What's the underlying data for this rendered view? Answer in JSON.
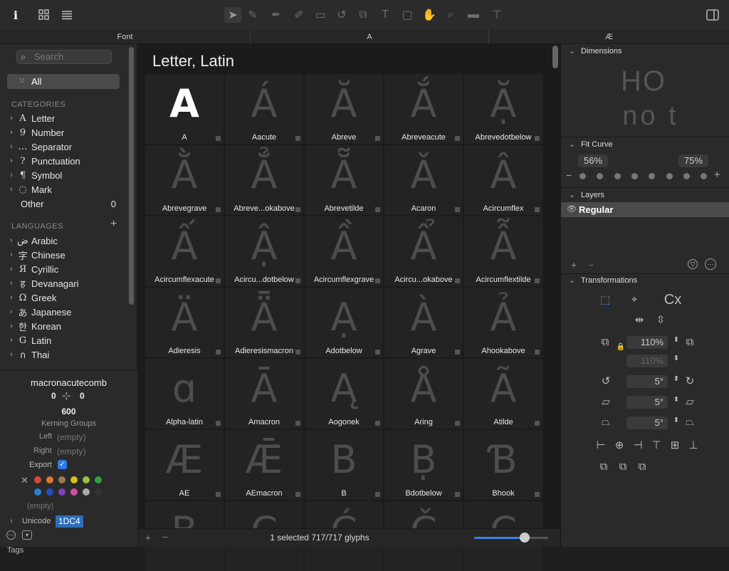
{
  "toolbar": {
    "left_icons": [
      "info-icon",
      "grid-view-icon",
      "list-view-icon"
    ],
    "tools": [
      "pointer-tool-icon",
      "edit-tool-icon",
      "pen-tool-icon",
      "brush-tool-icon",
      "rectangle-tool-icon",
      "rotate-tool-icon",
      "transform-tool-icon",
      "text-tool-icon",
      "annotation-tool-icon",
      "hand-tool-icon",
      "zoom-tool-icon",
      "measure-tool-icon",
      "trim-tool-icon"
    ],
    "right_icon": "sidebar-toggle-icon"
  },
  "tabs": [
    "Font",
    "A",
    "Æ"
  ],
  "sidebar": {
    "search_placeholder": "Search",
    "all_label": "All",
    "categories_header": "CATEGORIES",
    "categories": [
      {
        "icon": "A",
        "label": "Letter"
      },
      {
        "icon": "9",
        "label": "Number"
      },
      {
        "icon": "…",
        "label": "Separator"
      },
      {
        "icon": "?",
        "label": "Punctuation"
      },
      {
        "icon": "¶",
        "label": "Symbol"
      },
      {
        "icon": "◌",
        "label": "Mark"
      }
    ],
    "other_label": "Other",
    "other_count": "0",
    "languages_header": "LANGUAGES",
    "languages": [
      {
        "icon": "ض",
        "label": "Arabic"
      },
      {
        "icon": "字",
        "label": "Chinese"
      },
      {
        "icon": "Я",
        "label": "Cyrillic"
      },
      {
        "icon": "ह",
        "label": "Devanagari"
      },
      {
        "icon": "Ω",
        "label": "Greek"
      },
      {
        "icon": "あ",
        "label": "Japanese"
      },
      {
        "icon": "한",
        "label": "Korean"
      },
      {
        "icon": "G",
        "label": "Latin"
      },
      {
        "icon": "ก",
        "label": "Thai"
      }
    ],
    "glyph_info": {
      "name": "macronacutecomb",
      "lsb": "0",
      "rsb": "0",
      "width": "600",
      "kerning_groups": "Kerning Groups",
      "left_label": "Left",
      "left_value": "(empty)",
      "right_label": "Right",
      "right_value": "(empty)",
      "export_label": "Export",
      "tags_label": "Tags",
      "tags_value": "(empty)",
      "unicode_label": "Unicode",
      "unicode_value": "1DC4"
    },
    "colors": [
      "#d24a3a",
      "#e07a30",
      "#a07a50",
      "#d6c020",
      "#9ac040",
      "#30a040",
      "#2a80d0",
      "#2050c0",
      "#8040c0",
      "#d050a0",
      "#aaaaaa",
      "#333333"
    ]
  },
  "main": {
    "title": "Letter, Latin",
    "glyphs": [
      {
        "char": "A",
        "name": "A",
        "selected": true
      },
      {
        "char": "Á",
        "name": "Aacute"
      },
      {
        "char": "Ă",
        "name": "Abreve"
      },
      {
        "char": "Ắ",
        "name": "Abreveacute"
      },
      {
        "char": "Ặ",
        "name": "Abrevedotbelow"
      },
      {
        "char": "Ằ",
        "name": "Abrevegrave"
      },
      {
        "char": "Ẳ",
        "name": "Abreve...okabove"
      },
      {
        "char": "Ẵ",
        "name": "Abrevetilde"
      },
      {
        "char": "Ǎ",
        "name": "Acaron"
      },
      {
        "char": "Â",
        "name": "Acircumflex"
      },
      {
        "char": "Ấ",
        "name": "Acircumflexacute"
      },
      {
        "char": "Ậ",
        "name": "Acircu...dotbelow"
      },
      {
        "char": "Ầ",
        "name": "Acircumflexgrave"
      },
      {
        "char": "Ẩ",
        "name": "Acircu...okabove"
      },
      {
        "char": "Ẫ",
        "name": "Acircumflextilde"
      },
      {
        "char": "Ä",
        "name": "Adieresis"
      },
      {
        "char": "Ǟ",
        "name": "Adieresismacron"
      },
      {
        "char": "Ạ",
        "name": "Adotbelow"
      },
      {
        "char": "À",
        "name": "Agrave"
      },
      {
        "char": "Ả",
        "name": "Ahookabove"
      },
      {
        "char": "ɑ",
        "name": "Alpha-latin"
      },
      {
        "char": "Ā",
        "name": "Amacron"
      },
      {
        "char": "Ą",
        "name": "Aogonek"
      },
      {
        "char": "Å",
        "name": "Aring"
      },
      {
        "char": "Ã",
        "name": "Atilde"
      },
      {
        "char": "Æ",
        "name": "AE"
      },
      {
        "char": "Ǣ",
        "name": "AEmacron"
      },
      {
        "char": "B",
        "name": "B"
      },
      {
        "char": "Ḅ",
        "name": "Bdotbelow"
      },
      {
        "char": "Ɓ",
        "name": "Bhook"
      },
      {
        "char": "B",
        "name": ""
      },
      {
        "char": "C",
        "name": ""
      },
      {
        "char": "Ć",
        "name": ""
      },
      {
        "char": "Č",
        "name": ""
      },
      {
        "char": "C",
        "name": ""
      }
    ],
    "status_text": "1 selected 717/717 glyphs",
    "zoom": 0.68
  },
  "right_panel": {
    "dimensions_header": "Dimensions",
    "dim_preview_top": "HO",
    "dim_preview_bottom": "no t",
    "fit_curve_header": "Fit Curve",
    "fit_left": "56%",
    "fit_right": "75%",
    "layers_header": "Layers",
    "layer_name": "Regular",
    "transformations_header": "Transformations",
    "scale_x": "110%",
    "scale_y": "110%",
    "rotate": "5°",
    "slant": "5°",
    "skew": "5°"
  }
}
